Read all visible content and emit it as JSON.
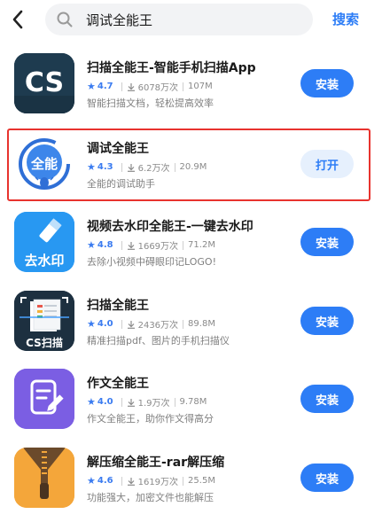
{
  "header": {
    "back_icon": "chevron-left-icon",
    "search_icon": "search-icon",
    "search_value": "调试全能王",
    "search_button": "搜索"
  },
  "colors": {
    "accent": "#2d7df6",
    "highlight_border": "#e8332e",
    "open_bg": "#e6f0fd"
  },
  "apps": [
    {
      "name": "扫描全能王-智能手机扫描App",
      "rating": "4.7",
      "downloads": "6078万次",
      "size": "107M",
      "desc": "智能扫描文档，轻松提高效率",
      "action": "安装",
      "icon": "cs-scanner-icon",
      "icon_text": "CS"
    },
    {
      "name": "调试全能王",
      "rating": "4.3",
      "downloads": "6.2万次",
      "size": "20.9M",
      "desc": "全能的调试助手",
      "action": "打开",
      "icon": "debug-bug-icon",
      "icon_text": "全能"
    },
    {
      "name": "视频去水印全能王-一键去水印",
      "rating": "4.8",
      "downloads": "1669万次",
      "size": "71.2M",
      "desc": "去除小视频中碍眼印记LOGO!",
      "action": "安装",
      "icon": "watermark-remover-icon",
      "icon_text": "去水印"
    },
    {
      "name": "扫描全能王",
      "rating": "4.0",
      "downloads": "2436万次",
      "size": "89.8M",
      "desc": "精准扫描pdf、图片的手机扫描仪",
      "action": "安装",
      "icon": "document-scan-icon",
      "icon_text": "CS扫描"
    },
    {
      "name": "作文全能王",
      "rating": "4.0",
      "downloads": "1.9万次",
      "size": "9.78M",
      "desc": "作文全能王，助你作文得高分",
      "action": "安装",
      "icon": "essay-edit-icon",
      "icon_text": ""
    },
    {
      "name": "解压缩全能王-rar解压缩",
      "rating": "4.6",
      "downloads": "1619万次",
      "size": "25.5M",
      "desc": "功能强大，加密文件也能解压",
      "action": "安装",
      "icon": "zip-archive-icon",
      "icon_text": ""
    }
  ]
}
